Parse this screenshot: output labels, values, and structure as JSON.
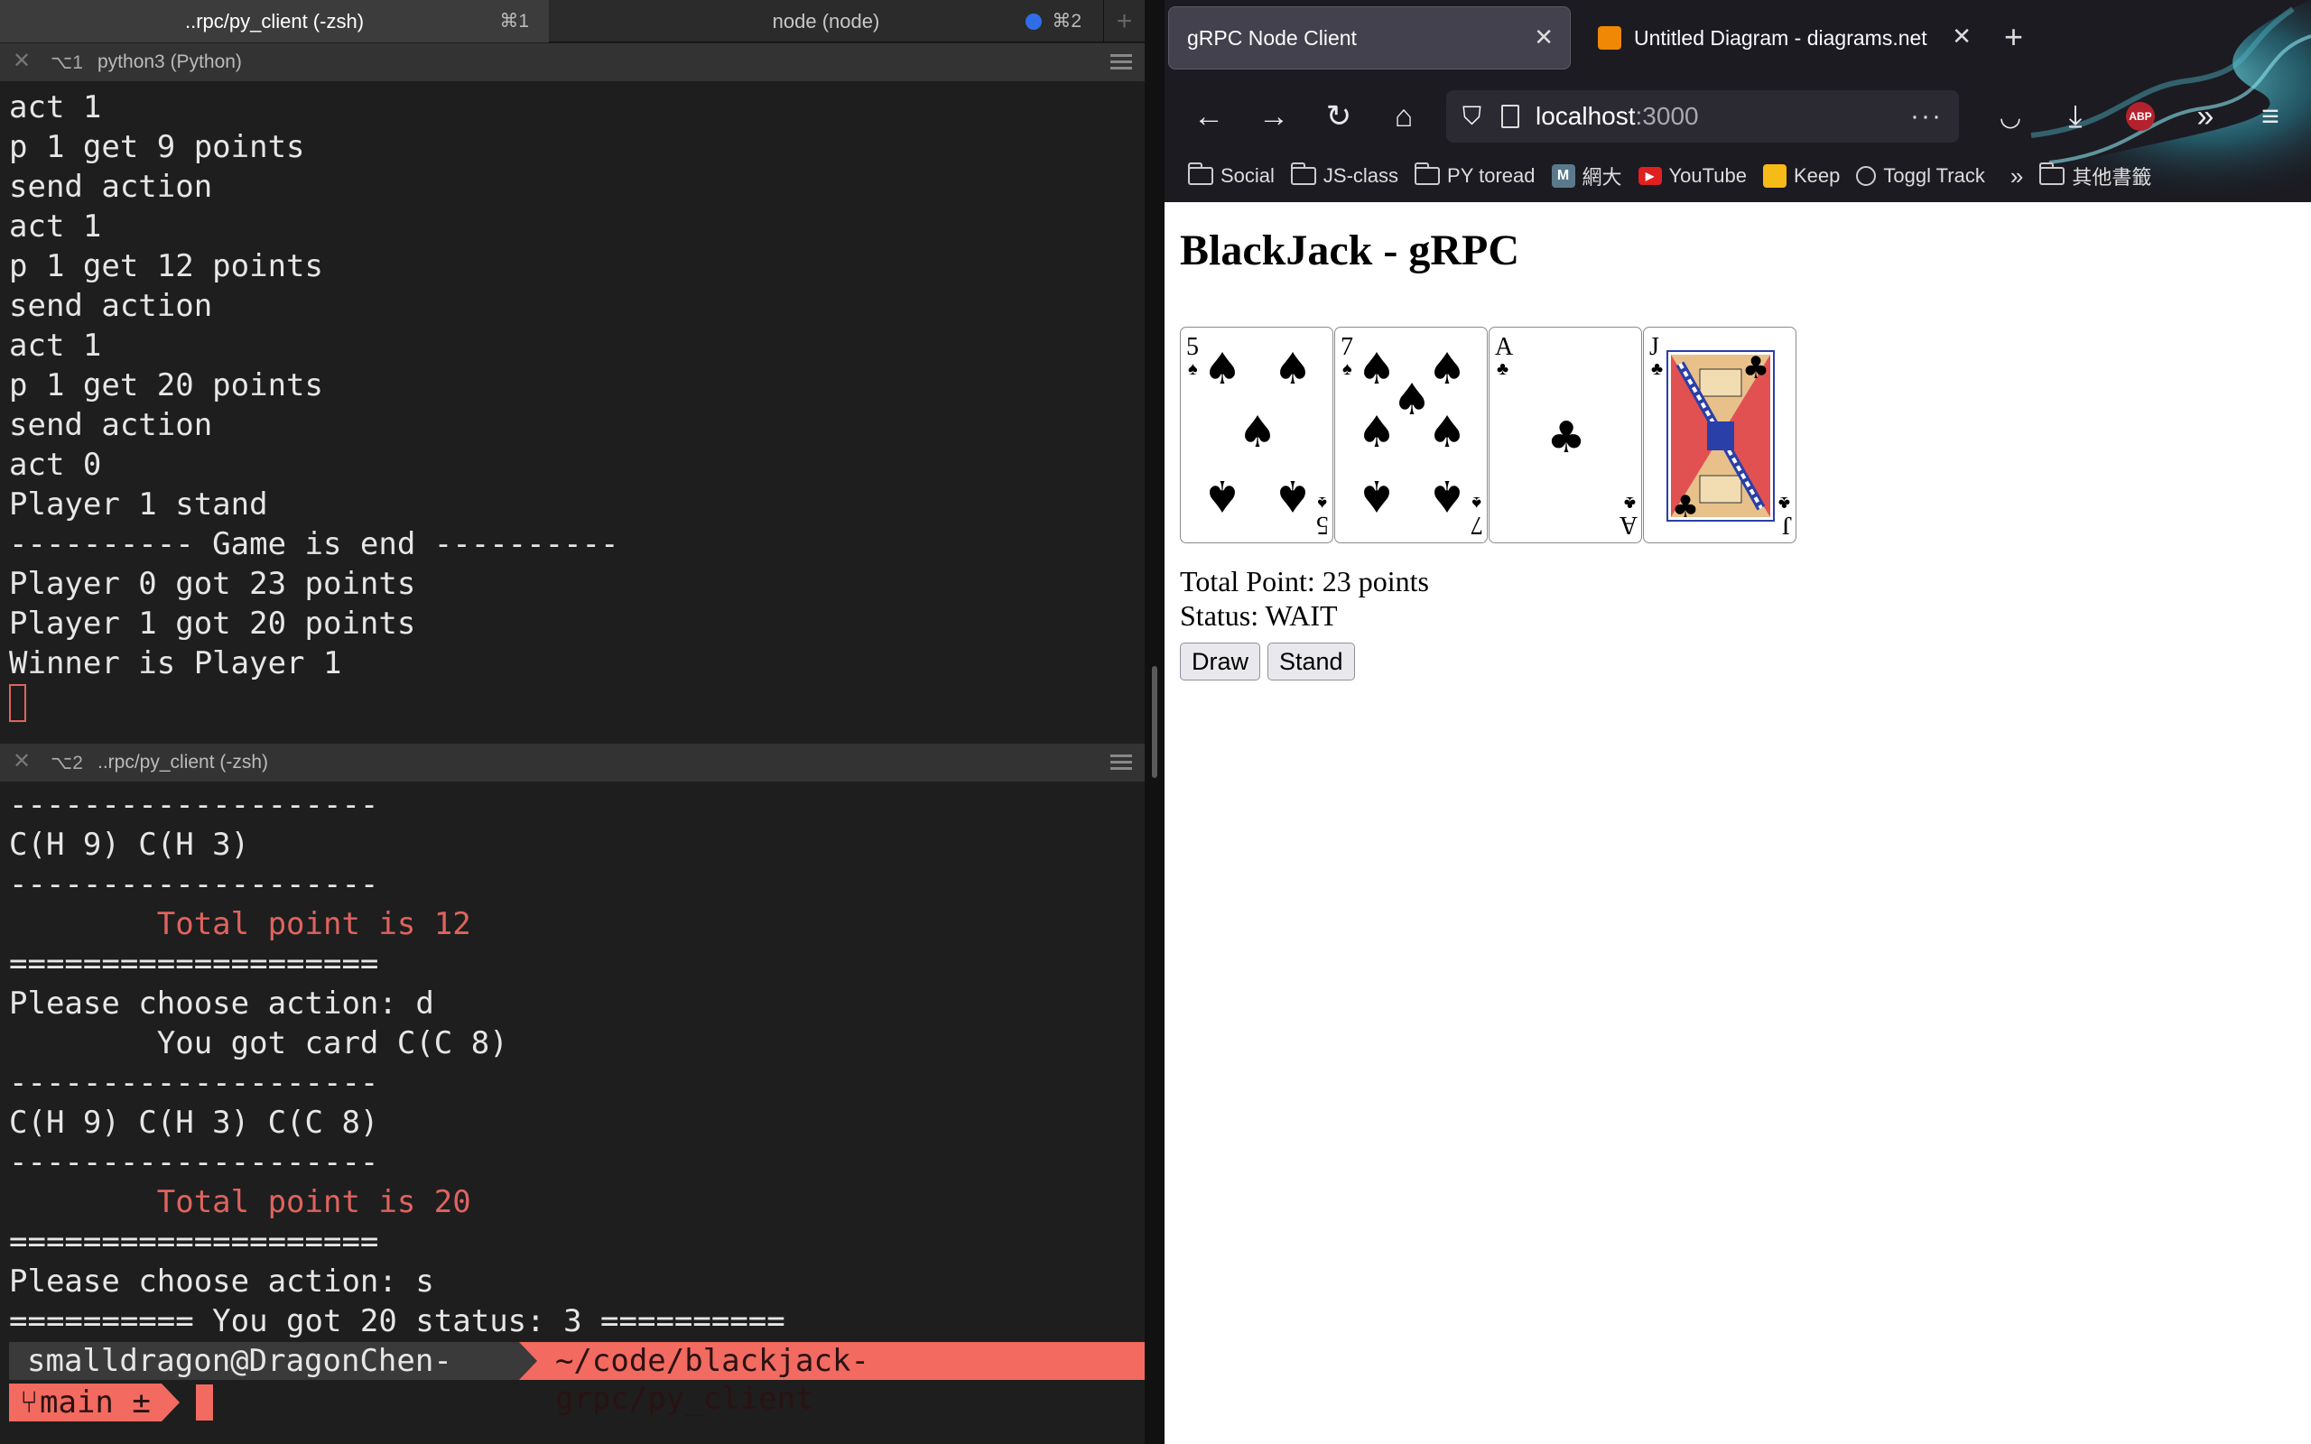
{
  "terminal": {
    "tabs": [
      {
        "label": "..rpc/py_client (-zsh)",
        "shortcut": "⌘1"
      },
      {
        "label": "node (node)",
        "shortcut": "⌘2"
      }
    ],
    "new_tab": "+",
    "pane1": {
      "number": "⌥1",
      "title": "python3 (Python)",
      "lines": [
        "act 1",
        "p 1 get 9 points",
        "send action",
        "act 1",
        "p 1 get 12 points",
        "send action",
        "act 1",
        "p 1 get 20 points",
        "send action",
        "act 0",
        "Player 1 stand",
        "---------- Game is end ----------",
        "Player 0 got 23 points",
        "Player 1 got 20 points",
        "Winner is Player 1"
      ]
    },
    "pane2": {
      "number": "⌥2",
      "title": "..rpc/py_client (-zsh)",
      "lines": [
        "--------------------",
        "C(H 9) C(H 3)",
        "--------------------",
        "        Total point is 12",
        "====================",
        "Please choose action: d",
        "        You got card C(C 8)",
        "--------------------",
        "C(H 9) C(H 3) C(C 8)",
        "--------------------",
        "        Total point is 20",
        "====================",
        "Please choose action: s",
        "========== You got 20 status: 3 =========="
      ],
      "prompt_user": "smalldragon@DragonChen-MBP",
      "prompt_path": "~/code/blackjack-grpc/py_client",
      "prompt_branch": "main ±"
    }
  },
  "browser": {
    "tabs": [
      {
        "title": "gRPC Node Client",
        "close": "✕"
      },
      {
        "title": "Untitled Diagram - diagrams.net",
        "close": "✕"
      }
    ],
    "new_tab": "+",
    "url_host": "localhost",
    "url_port": ":3000",
    "url_menu": "···",
    "bookmarks": [
      {
        "label": "Social",
        "icon": "folder-icon"
      },
      {
        "label": "JS-class",
        "icon": "folder-icon"
      },
      {
        "label": "PY toread",
        "icon": "folder-icon"
      },
      {
        "label": "網大",
        "icon": "m-icon"
      },
      {
        "label": "YouTube",
        "icon": "youtube-icon"
      },
      {
        "label": "Keep",
        "icon": "keep-icon"
      },
      {
        "label": "Toggl Track",
        "icon": "toggl-icon"
      },
      {
        "label": "其他書籤",
        "icon": "folder-icon"
      }
    ],
    "page": {
      "heading": "BlackJack - gRPC",
      "cards": [
        {
          "rank": "5",
          "suit": "♠"
        },
        {
          "rank": "7",
          "suit": "♠"
        },
        {
          "rank": "A",
          "suit": "♣"
        },
        {
          "rank": "J",
          "suit": "♣"
        }
      ],
      "total": "Total Point: 23 points",
      "status": "Status: WAIT",
      "draw_button": "Draw",
      "stand_button": "Stand"
    }
  }
}
